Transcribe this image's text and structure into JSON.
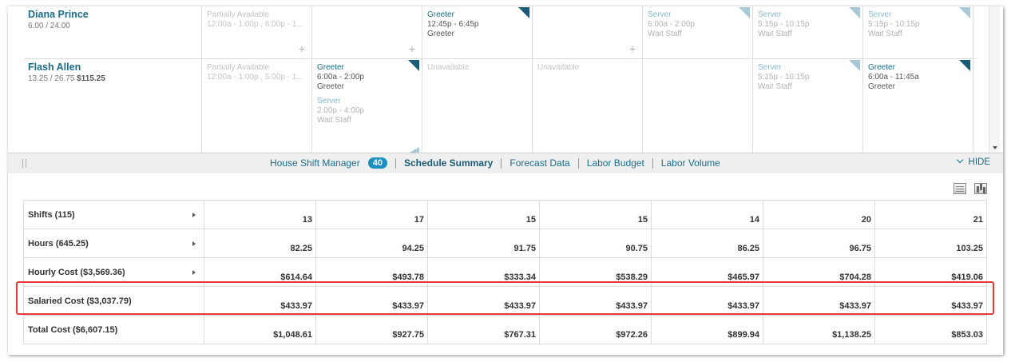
{
  "schedule": {
    "rows": [
      {
        "name": "Diana Prince",
        "hours": "6.00 / 24.00",
        "cost": "",
        "days": [
          {
            "shifts": [
              {
                "kind": "avail",
                "role": "Partially Available",
                "time": "12:00a - 1:00p , 6:00p - 1..."
              }
            ],
            "plus": true
          },
          {
            "shifts": [],
            "plus": true
          },
          {
            "shifts": [
              {
                "kind": "pub",
                "role": "Greeter",
                "time": "12:45p - 6:45p",
                "pos": "Greeter"
              }
            ],
            "corner": "pub"
          },
          {
            "shifts": [],
            "plus": true
          },
          {
            "shifts": [
              {
                "kind": "unpub",
                "role": "Server",
                "time": "6:00a - 2:00p",
                "pos": "Wait Staff"
              }
            ],
            "corner": "unpub"
          },
          {
            "shifts": [
              {
                "kind": "unpub",
                "role": "Server",
                "time": "5:15p - 10:15p",
                "pos": "Wait Staff"
              }
            ],
            "corner": "unpub"
          },
          {
            "shifts": [
              {
                "kind": "unpub",
                "role": "Server",
                "time": "5:15p - 10:15p",
                "pos": "Wait Staff"
              }
            ],
            "corner": "unpub"
          }
        ]
      },
      {
        "name": "Flash Allen",
        "hours": "13.25 / 26.75",
        "cost": "$115.25",
        "days": [
          {
            "shifts": [
              {
                "kind": "avail",
                "role": "Partially Available",
                "time": "12:00a - 1:00p , 5:00p - 1..."
              }
            ]
          },
          {
            "shifts": [
              {
                "kind": "pub",
                "role": "Greeter",
                "time": "6:00a - 2:00p",
                "pos": "Greeter"
              },
              {
                "kind": "unpub",
                "role": "Server",
                "time": "2:00p - 4:00p",
                "pos": "Wait Staff"
              }
            ],
            "corner": "pub",
            "corner_bottom": true
          },
          {
            "shifts": [
              {
                "kind": "avail",
                "role": "Unavailable",
                "time": ""
              }
            ]
          },
          {
            "shifts": [
              {
                "kind": "avail",
                "role": "Unavailable",
                "time": ""
              }
            ]
          },
          {
            "shifts": []
          },
          {
            "shifts": [
              {
                "kind": "unpub",
                "role": "Server",
                "time": "5:15p - 10:15p",
                "pos": "Wait Staff"
              }
            ],
            "corner": "unpub"
          },
          {
            "shifts": [
              {
                "kind": "pub",
                "role": "Greeter",
                "time": "6:00a - 11:45a",
                "pos": "Greeter"
              }
            ],
            "corner": "pub"
          }
        ]
      }
    ]
  },
  "tabbar": {
    "tabs": [
      {
        "label": "House Shift Manager",
        "badge": "40",
        "active": false
      },
      {
        "label": "Schedule Summary",
        "active": true
      },
      {
        "label": "Forecast Data",
        "active": false
      },
      {
        "label": "Labor Budget",
        "active": false
      },
      {
        "label": "Labor Volume",
        "active": false
      }
    ],
    "hide_label": "HIDE"
  },
  "view_icons": [
    "table-view-icon",
    "chart-view-icon"
  ],
  "summary": {
    "rows": [
      {
        "label": "Shifts (115)",
        "values": [
          "13",
          "17",
          "15",
          "15",
          "14",
          "20",
          "21"
        ],
        "expandable": true
      },
      {
        "label": "Hours (645.25)",
        "values": [
          "82.25",
          "94.25",
          "91.75",
          "90.75",
          "86.25",
          "96.75",
          "103.25"
        ],
        "expandable": true
      },
      {
        "label": "Hourly Cost ($3,569.36)",
        "values": [
          "$614.64",
          "$493.78",
          "$333.34",
          "$538.29",
          "$465.97",
          "$704.28",
          "$419.06"
        ],
        "expandable": true
      },
      {
        "label": "Salaried Cost ($3,037.79)",
        "values": [
          "$433.97",
          "$433.97",
          "$433.97",
          "$433.97",
          "$433.97",
          "$433.97",
          "$433.97"
        ],
        "expandable": false,
        "highlighted": true
      },
      {
        "label": "Total Cost ($6,607.15)",
        "values": [
          "$1,048.61",
          "$927.75",
          "$767.31",
          "$972.26",
          "$899.94",
          "$1,138.25",
          "$853.03"
        ],
        "expandable": false
      }
    ]
  },
  "colors": {
    "accent": "#1a6d8c",
    "badge": "#1a8fc2",
    "highlight": "#e53935"
  }
}
